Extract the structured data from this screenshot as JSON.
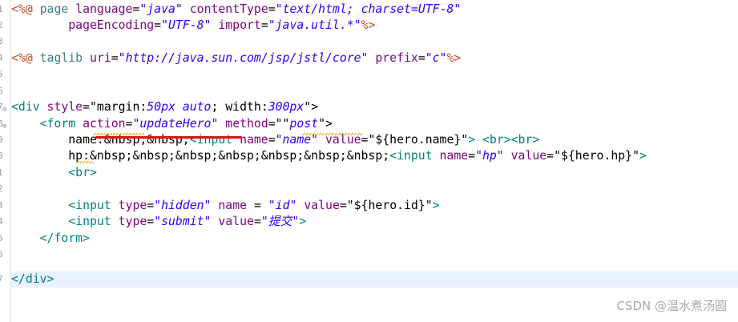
{
  "gutter": {
    "line_numbers": [
      "1",
      "2",
      "3",
      "4",
      "5",
      "6",
      "7",
      "8",
      "9",
      "0",
      "1",
      "2",
      "3",
      "4",
      "5",
      "6",
      "7"
    ]
  },
  "code": {
    "l1": {
      "a": "<%@ ",
      "b": "page ",
      "c": "language",
      "d": "=",
      "e": "\"java\"",
      "f": " contentType",
      "g": "=",
      "h": "\"text/html; charset=UTF-8\""
    },
    "l2": {
      "a": "        pageEncoding",
      "b": "=",
      "c": "\"UTF-8\"",
      "d": " import",
      "e": "=",
      "f": "\"java.util.*\"",
      "g": "%>"
    },
    "l4": {
      "a": "<%@ ",
      "b": "taglib ",
      "c": "uri",
      "d": "=",
      "e": "\"http://java.sun.com/jsp/jstl/core\"",
      "f": " prefix",
      "g": "=",
      "h": "\"c\"",
      "i": "%>"
    },
    "l7": {
      "a": "<div ",
      "b": "style",
      "c": "=\"margin:",
      "d": "50px auto",
      "e": "; width:",
      "f": "300px",
      "g": "\">"
    },
    "l8": {
      "a": "    <form ",
      "b": "action",
      "c": "=",
      "d": "\"updateHero\"",
      "e": " method",
      "f": "=\"\"",
      "g": "post",
      "h": "\">"
    },
    "l9": {
      "a": "        name:&nbsp;&nbsp;",
      "b": "<input ",
      "c": "name",
      "d": "=",
      "e": "\"name\"",
      "f": " value",
      "g": "=\"${hero.name}\"",
      "h": "> ",
      "i": "<br><br>"
    },
    "l10": {
      "a": "        hp:&nbsp;&nbsp;&nbsp;&nbsp;&nbsp;&nbsp;&nbsp;",
      "b": "<input ",
      "c": "name",
      "d": "=",
      "e": "\"hp\"",
      "f": " value",
      "g": "=\"${hero.hp}\"",
      "h": ">"
    },
    "l11": {
      "a": "        <br>"
    },
    "l13": {
      "a": "        <input ",
      "b": "type",
      "c": "=",
      "d": "\"hidden\"",
      "e": " name",
      "f": " = ",
      "g": "\"id\"",
      "h": " value",
      "i": "=\"${hero.id}\"",
      "j": ">"
    },
    "l14": {
      "a": "        <input ",
      "b": "type",
      "c": "=",
      "d": "\"submit\"",
      "e": " value",
      "f": "=",
      "g": "\"提交\"",
      "h": ">"
    },
    "l15": {
      "a": "    </form>"
    },
    "l17": {
      "a": "</div>"
    }
  },
  "colors": {
    "directive": "#c0502b",
    "attribute": "#7f007f",
    "string": "#2a00ff",
    "tag": "#008080",
    "annotation_underline": "#e01010",
    "current_line": "#e8f2fe"
  },
  "watermark": "CSDN @温水煮汤圆"
}
